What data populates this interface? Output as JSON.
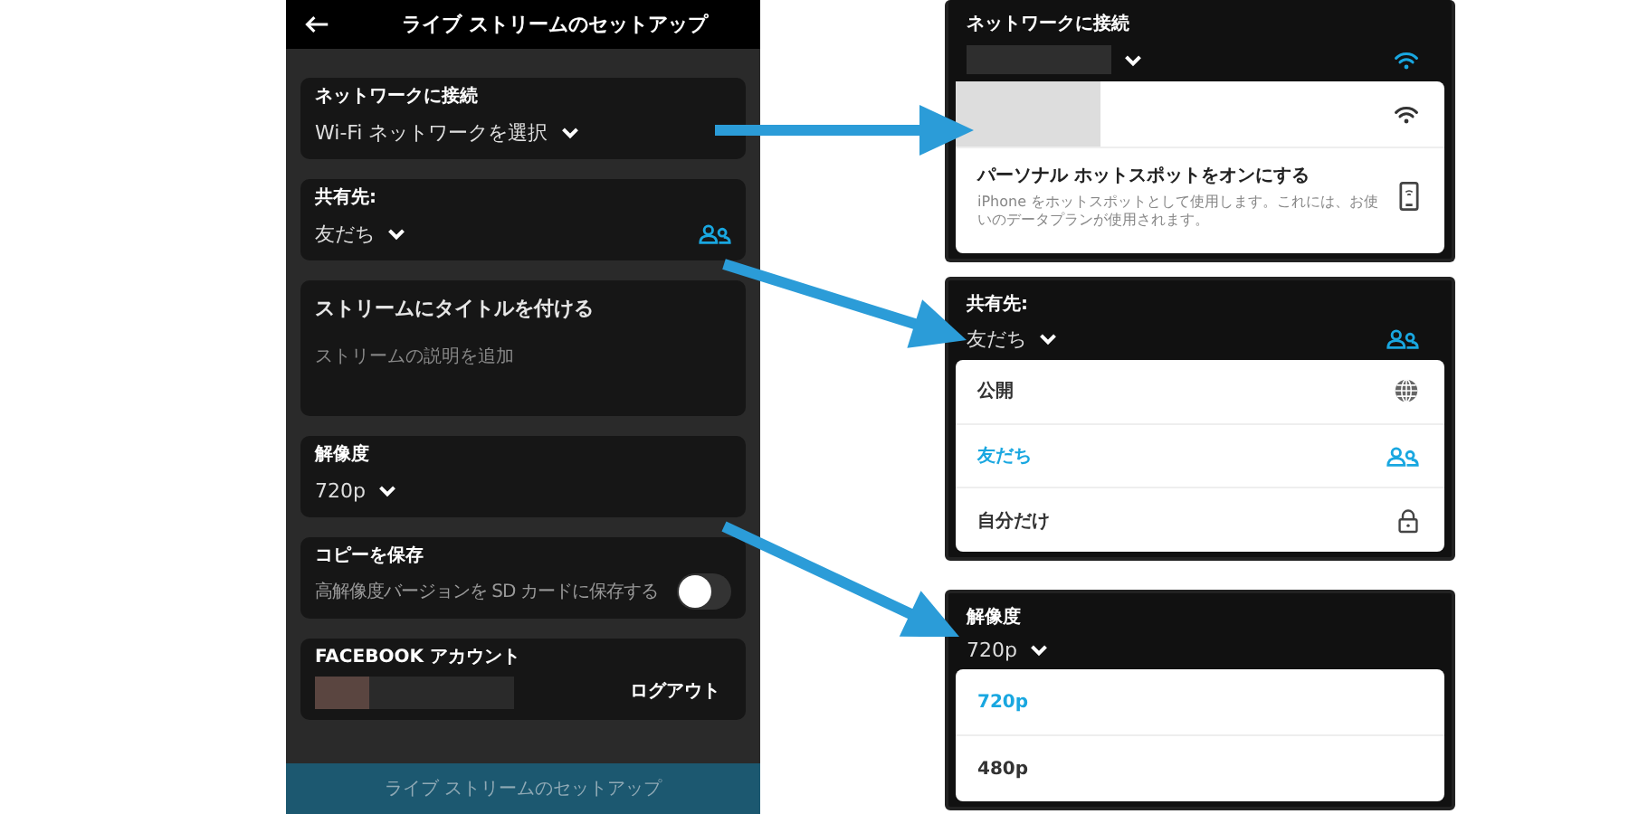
{
  "header": {
    "title": "ライブ ストリームのセットアップ"
  },
  "network": {
    "label": "ネットワークに接続",
    "value": "Wi-Fi ネットワークを選択"
  },
  "share": {
    "label": "共有先:",
    "value": "友だち"
  },
  "stream_title": {
    "title": "ストリームにタイトルを付ける",
    "placeholder": "ストリームの説明を追加"
  },
  "resolution": {
    "label": "解像度",
    "value": "720p"
  },
  "save_copy": {
    "label": "コピーを保存",
    "text": "高解像度バージョンを SD カードに保存する",
    "on": false
  },
  "facebook": {
    "label": "FACEBOOK アカウント",
    "logout": "ログアウト"
  },
  "footer_button": {
    "label": "ライブ ストリームのセットアップ",
    "disabled": true
  },
  "callouts": [
    {
      "kind": "network",
      "label": "ネットワークに接続",
      "options": [
        {
          "kind": "wifi"
        },
        {
          "kind": "hotspot",
          "title": "パーソナル ホットスポットをオンにする",
          "text": "iPhone をホットスポットとして使用します。これには、お使いのデータプランが使用されます。"
        }
      ]
    },
    {
      "kind": "share",
      "label": "共有先:",
      "value": "友だち",
      "options": [
        {
          "kind": "public",
          "label": "公開",
          "selected": false
        },
        {
          "kind": "friends",
          "label": "友だち",
          "selected": true
        },
        {
          "kind": "only-me",
          "label": "自分だけ",
          "selected": false
        }
      ]
    },
    {
      "kind": "resolution",
      "label": "解像度",
      "value": "720p",
      "options": [
        {
          "kind": "text",
          "label": "720p",
          "selected": true
        },
        {
          "kind": "text",
          "label": "480p",
          "selected": false
        }
      ]
    }
  ]
}
